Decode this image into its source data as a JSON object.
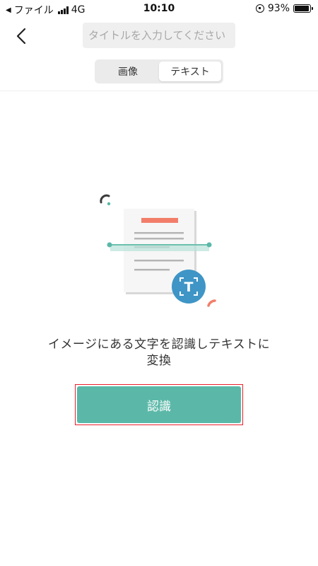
{
  "status_bar": {
    "back_app_glyph": "◀",
    "carrier": "ファイル",
    "network": "4G",
    "time": "10:10",
    "battery_percent": "93%",
    "battery_level": 0.93
  },
  "header": {
    "title_placeholder": "タイトルを入力してください",
    "title_value": ""
  },
  "segmented": {
    "tabs": [
      {
        "label": "画像",
        "active": false
      },
      {
        "label": "テキスト",
        "active": true
      }
    ]
  },
  "main": {
    "message": "イメージにある文字を認識しテキストに変換",
    "recognize_button_label": "認識",
    "illustration_glyph": "T"
  },
  "colors": {
    "accent": "#5bb8a8",
    "accent_light": "#b8e3d9",
    "scan_line": "#6cc0ae",
    "doc_header": "#f27e6a",
    "icon_blue": "#3e95c6",
    "highlight": "#e8202a"
  }
}
